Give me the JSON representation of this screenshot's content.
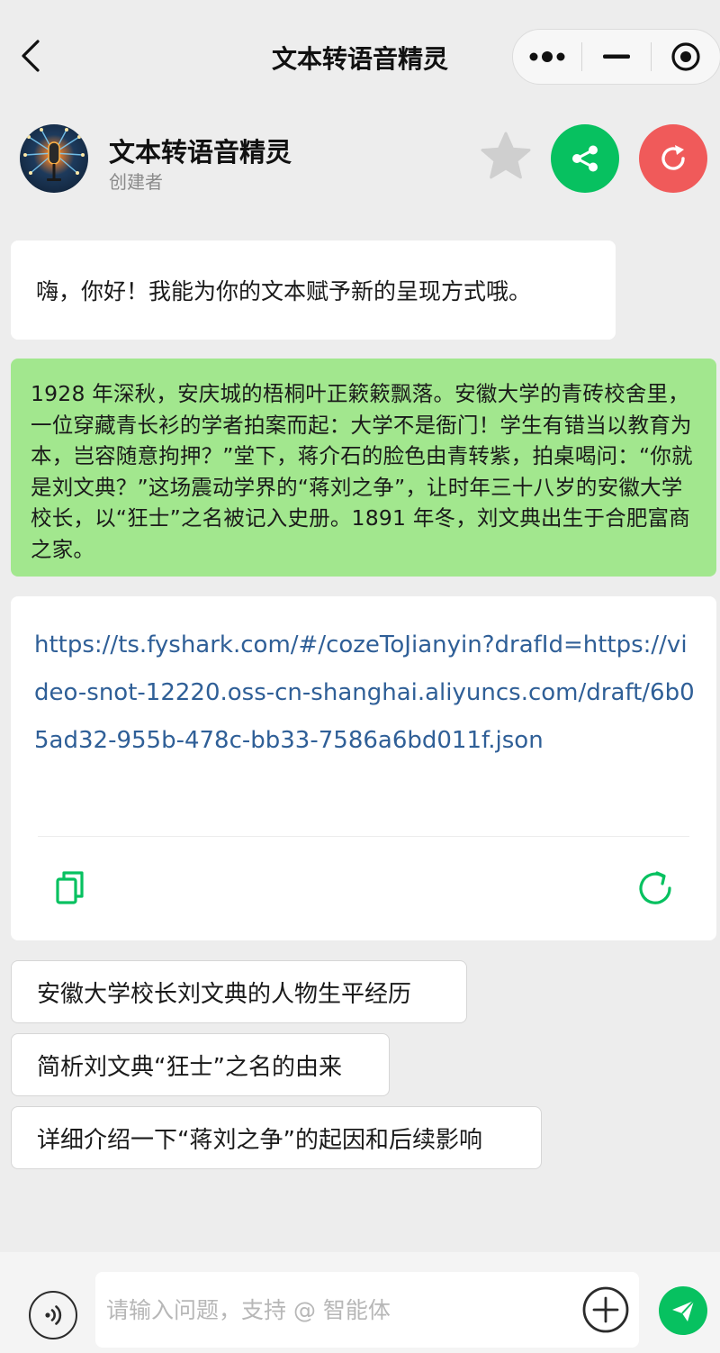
{
  "nav": {
    "title": "文本转语音精灵"
  },
  "bot": {
    "name": "文本转语音精灵",
    "role": "创建者"
  },
  "messages": {
    "greeting": "嗨，你好！我能为你的文本赋予新的呈现方式哦。",
    "user_text": "1928 年深秋，安庆城的梧桐叶正簌簌飘落。安徽大学的青砖校舍里，一位穿藏青长衫的学者拍案而起：大学不是衙门！学生有错当以教育为本，岂容随意拘押？”堂下，蒋介石的脸色由青转紫，拍桌喝问：“你就是刘文典？”这场震动学界的“蒋刘之争”，让时年三十八岁的安徽大学校长，以“狂士”之名被记入史册。1891 年冬，刘文典出生于合肥富商之家。",
    "reply_link": "https://ts.fyshark.com/#/cozeToJianyin?drafId=https://video-snot-12220.oss-cn-shanghai.aliyuncs.com/draft/6b05ad32-955b-478c-bb33-7586a6bd011f.json"
  },
  "suggestions": [
    "安徽大学校长刘文典的人物生平经历",
    "简析刘文典“狂士”之名的由来",
    "详细介绍一下“蒋刘之争”的起因和后续影响"
  ],
  "input": {
    "placeholder": "请输入问题，支持 @ 智能体",
    "value": ""
  },
  "colors": {
    "accent_green": "#07c160",
    "user_bubble": "#a2e78e",
    "refresh_red": "#f05a5a",
    "link_blue": "#2f5f97",
    "background": "#ededed"
  },
  "icons": [
    "back-arrow-icon",
    "more-dots-icon",
    "minimize-icon",
    "close-target-icon",
    "star-icon",
    "share-icon",
    "refresh-icon",
    "copy-icon",
    "regenerate-icon",
    "voice-icon",
    "plus-icon",
    "send-icon"
  ]
}
